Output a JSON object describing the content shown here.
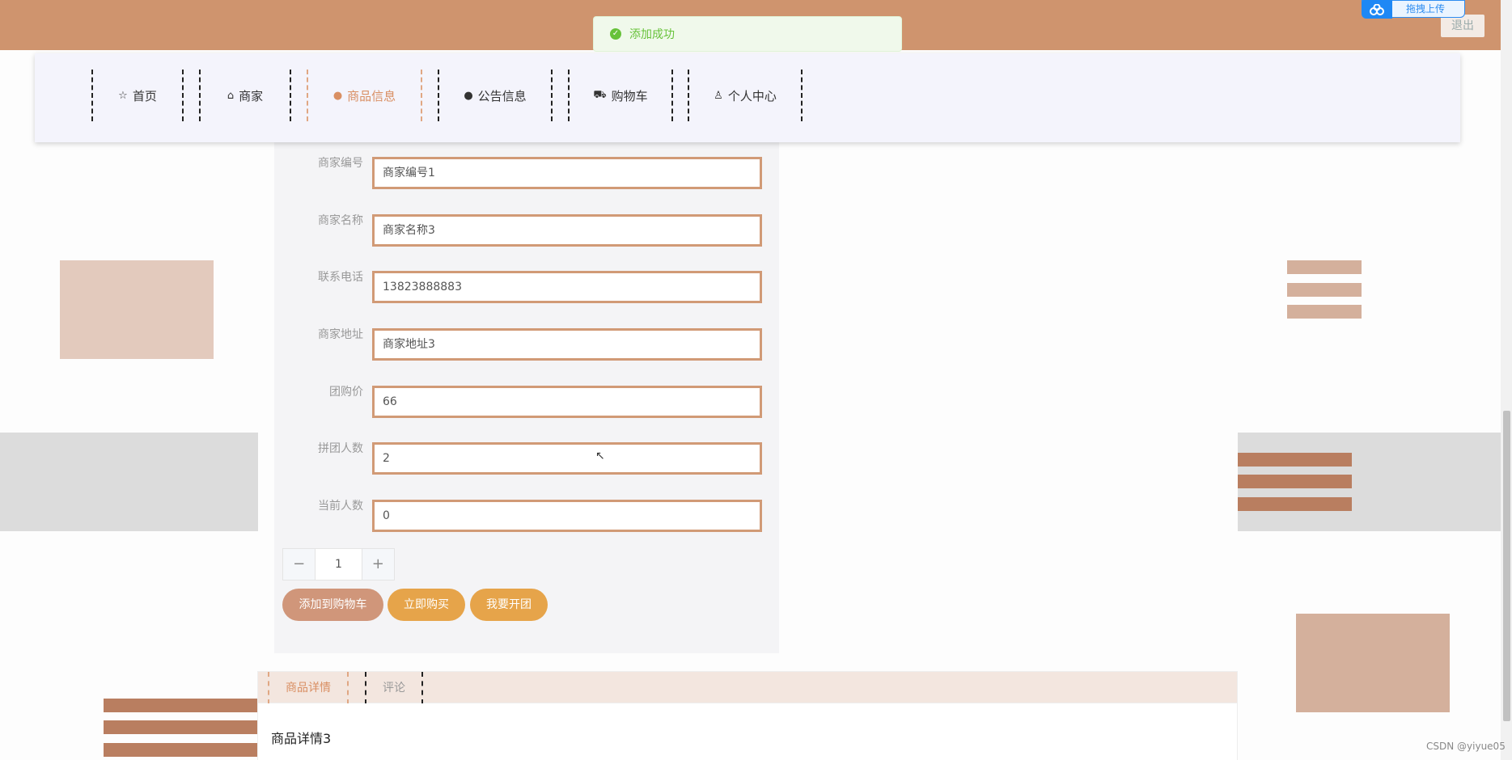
{
  "header": {
    "logout_label": "退出"
  },
  "upload_widget": {
    "label": "拖拽上传"
  },
  "toast": {
    "message": "添加成功"
  },
  "nav": {
    "items": [
      {
        "label": "首页",
        "icon": "star-icon"
      },
      {
        "label": "商家",
        "icon": "bag-icon"
      },
      {
        "label": "商品信息",
        "icon": "info-icon",
        "active": true
      },
      {
        "label": "公告信息",
        "icon": "question-icon"
      },
      {
        "label": "购物车",
        "icon": "cart-icon"
      },
      {
        "label": "个人中心",
        "icon": "user-icon"
      }
    ]
  },
  "form": {
    "fields": [
      {
        "label": "商家编号",
        "value": "商家编号1"
      },
      {
        "label": "商家名称",
        "value": "商家名称3"
      },
      {
        "label": "联系电话",
        "value": "13823888883"
      },
      {
        "label": "商家地址",
        "value": "商家地址3"
      },
      {
        "label": "团购价",
        "value": "66"
      },
      {
        "label": "拼团人数",
        "value": "2"
      },
      {
        "label": "当前人数",
        "value": "0"
      }
    ]
  },
  "quantity": {
    "value": "1",
    "minus": "−",
    "plus": "+"
  },
  "actions": {
    "add_to_cart": "添加到购物车",
    "buy_now": "立即购买",
    "start_group": "我要开团"
  },
  "tabs": [
    {
      "label": "商品详情",
      "active": true
    },
    {
      "label": "评论"
    }
  ],
  "detail": {
    "text": "商品详情3"
  },
  "watermark": "CSDN @yiyue05",
  "colors": {
    "topbar": "#cf946e",
    "nav_bg": "#f4f4fc",
    "accent": "#d98f63",
    "input_border": "#d19a76",
    "cart_button": "#d0967a",
    "buy_button": "#e6a44a",
    "toast_bg": "#f0f9eb",
    "toast_text": "#67c23a"
  }
}
